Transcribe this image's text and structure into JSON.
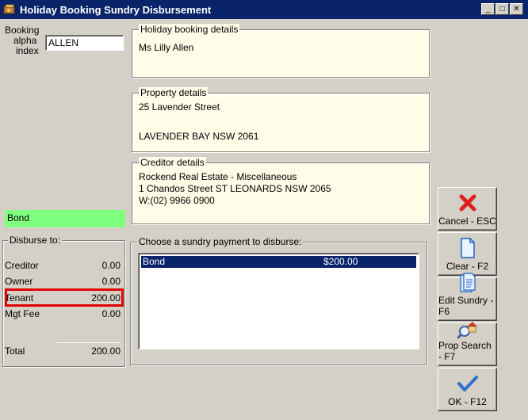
{
  "window": {
    "title": "Holiday Booking Sundry Disbursement",
    "minimize_glyph": "_",
    "maximize_glyph": "□",
    "close_glyph": "✕"
  },
  "booking": {
    "label_line1": "Booking",
    "label_line2": "alpha",
    "label_line3": "index",
    "value": "ALLEN"
  },
  "holiday_details": {
    "title": "Holiday booking details",
    "line1": "Ms Lilly Allen"
  },
  "property_details": {
    "title": "Property details",
    "line1": "25 Lavender Street",
    "line2": "LAVENDER BAY  NSW  2061"
  },
  "creditor_details": {
    "title": "Creditor details",
    "line1": "Rockend Real Estate - Miscellaneous",
    "line2": "1 Chandos Street ST LEONARDS NSW 2065",
    "line3": "W:(02) 9966 0900"
  },
  "selected_sundry": "Bond",
  "disburse": {
    "title": "Disburse to:",
    "rows": [
      {
        "label": "Creditor",
        "value": "0.00"
      },
      {
        "label": "Owner",
        "value": "0.00"
      },
      {
        "label": "Tenant",
        "value": "200.00"
      },
      {
        "label": "Mgt Fee",
        "value": "0.00"
      }
    ],
    "total_label": "Total",
    "total_value": "200.00"
  },
  "sundry_list": {
    "title": "Choose a sundry payment to disburse:",
    "items": [
      {
        "name": "Bond",
        "amount": "$200.00",
        "selected": true
      }
    ]
  },
  "toolbar": {
    "cancel": "Cancel - ESC",
    "clear": "Clear - F2",
    "edit_sundry": "Edit Sundry - F6",
    "prop_search": "Prop Search - F7",
    "ok": "OK - F12"
  },
  "colors": {
    "titlebar": "#0a246a",
    "panel_cream": "#fefde8",
    "bond_green": "#7fff7f",
    "highlight_red": "#e00000",
    "selection_blue": "#0a246a"
  },
  "icons": {
    "cancel": "red-x-icon",
    "clear": "blank-page-icon",
    "edit_sundry": "document-icon",
    "prop_search": "house-search-icon",
    "ok": "checkmark-icon"
  }
}
